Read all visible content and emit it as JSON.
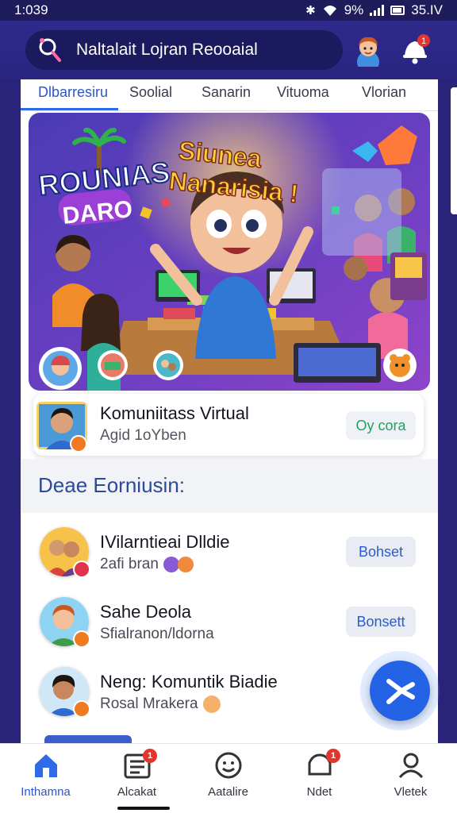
{
  "status_bar": {
    "time": "1:039",
    "battery_text": "9%",
    "carrier_text": "35.IV"
  },
  "header": {
    "search_text": "Naltalait Lojran Reooaial",
    "icons": [
      "search-icon",
      "profile-avatar",
      "notification-bell-icon"
    ],
    "notification_badge": "1"
  },
  "tabs": [
    {
      "label": "Dlbarresiru",
      "active": true
    },
    {
      "label": "Soolial"
    },
    {
      "label": "Sanarin"
    },
    {
      "label": "Vituoma"
    },
    {
      "label": "Vlorian"
    }
  ],
  "banner": {
    "headline_left_1": "ROUNIAS",
    "headline_left_2": "DARO",
    "headline_right_1": "Siunea",
    "headline_right_2": "Nanarisia !",
    "colors": {
      "bg_left": "#4b3bb5",
      "bg_right": "#8e44c9",
      "accent": "#ffb020"
    }
  },
  "community_card": {
    "title": "Komuniitass Virtual",
    "subtitle": "Agid 1oYben",
    "button": "Oy cora"
  },
  "section": {
    "title": "Deae Eorniusin:"
  },
  "list": [
    {
      "title": "IVilarntieai Dlldie",
      "subtitle": "2afi bran",
      "button": "Bohset",
      "badge_color": "#e2354b"
    },
    {
      "title": "Sahe Deola",
      "subtitle": "Sfialranon/ldorna",
      "button": "Bonsett",
      "badge_color": "#f07a22"
    },
    {
      "title": "Neng: Komuntik Biadie",
      "subtitle": "Rosal Mrakera",
      "button": "",
      "badge_color": "#f07a22"
    }
  ],
  "bottom_nav": [
    {
      "label": "Inthamna",
      "icon": "home-icon",
      "active": true,
      "badge": ""
    },
    {
      "label": "Alcakat",
      "icon": "news-icon",
      "badge": "1"
    },
    {
      "label": "Aatalire",
      "icon": "smiley-icon",
      "badge": ""
    },
    {
      "label": "Ndet",
      "icon": "chat-icon",
      "badge": "1"
    },
    {
      "label": "Vletek",
      "icon": "profile-icon",
      "badge": ""
    }
  ]
}
